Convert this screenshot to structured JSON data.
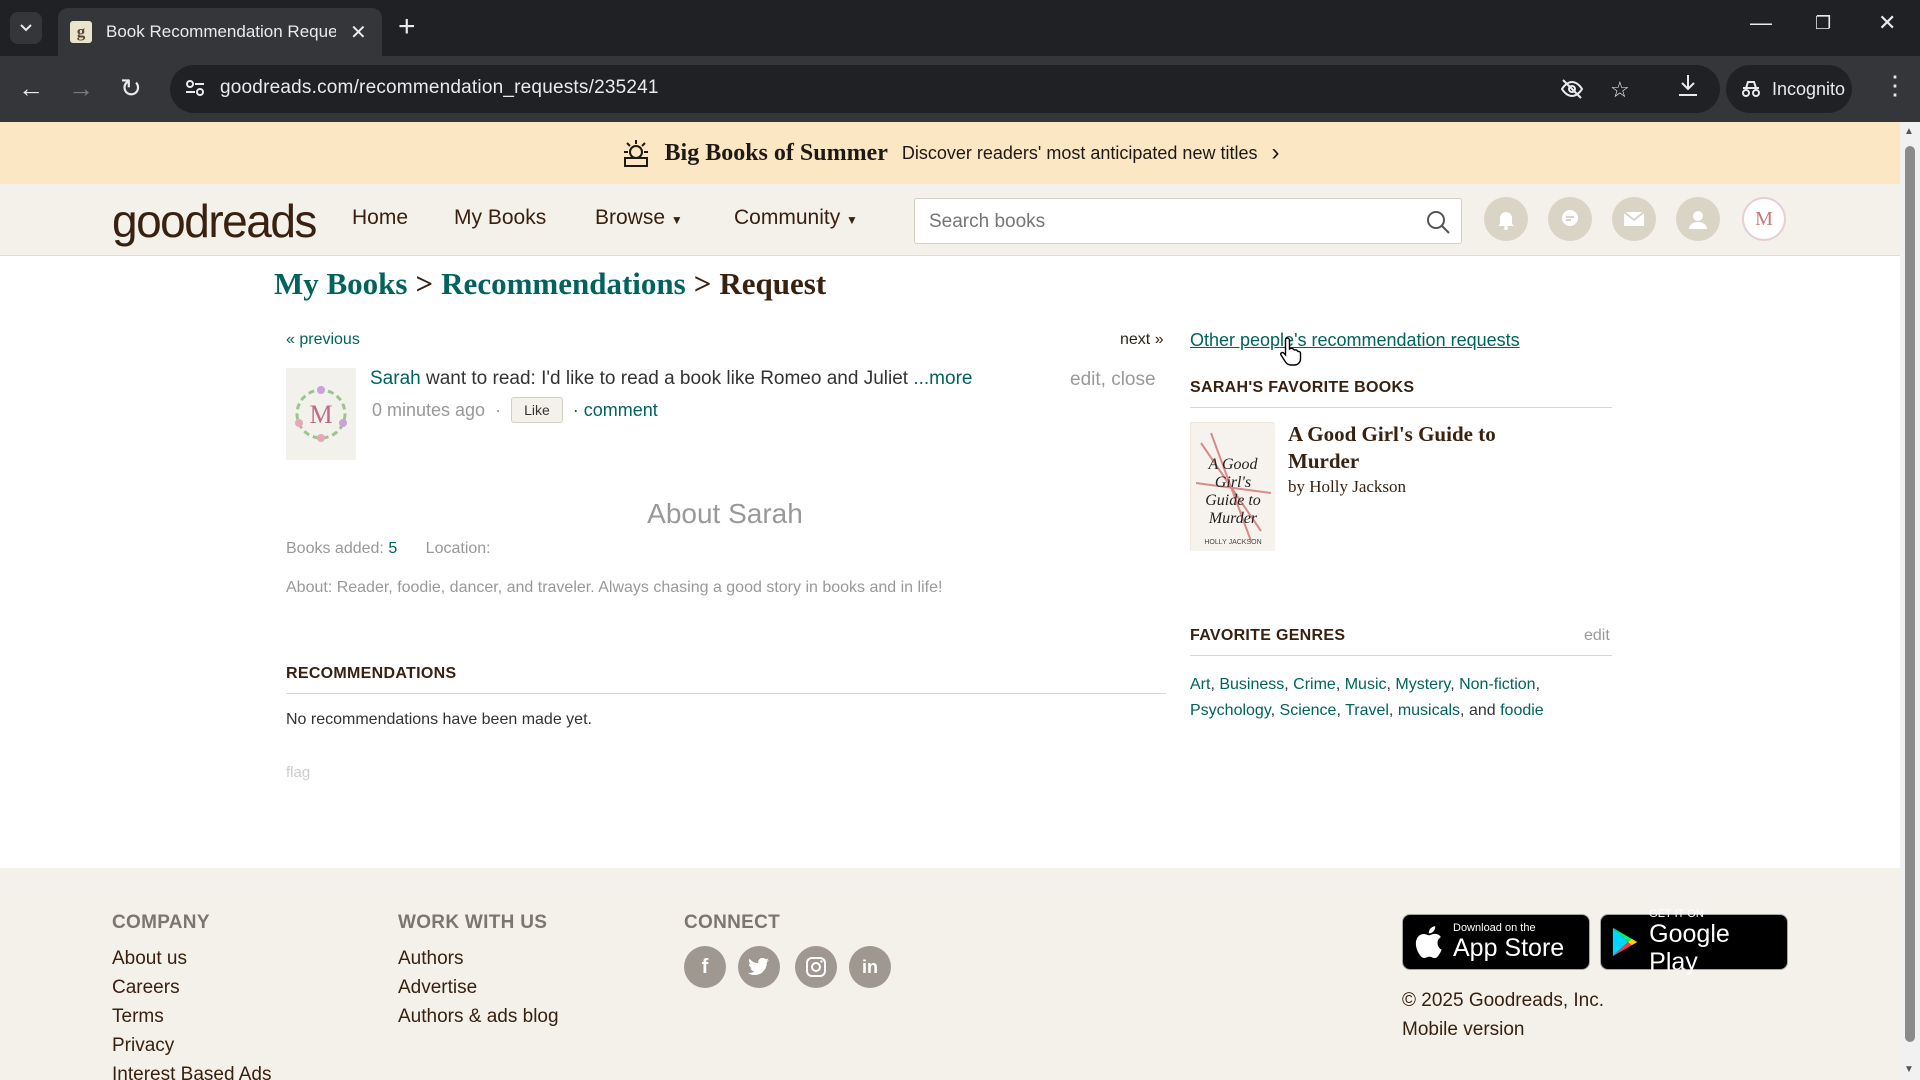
{
  "browser": {
    "tab_title": "Book Recommendation Reques",
    "url": "goodreads.com/recommendation_requests/235241",
    "incognito_label": "Incognito",
    "favicon_letter": "g"
  },
  "banner": {
    "title": "Big Books of Summer",
    "subtitle": "Discover readers' most anticipated new titles"
  },
  "header": {
    "logo": "goodreads",
    "nav": [
      "Home",
      "My Books",
      "Browse",
      "Community"
    ],
    "search_placeholder": "Search books"
  },
  "breadcrumb": {
    "items": [
      "My Books",
      "Recommendations",
      "Request"
    ],
    "separator": ">"
  },
  "request": {
    "previous": "« previous",
    "next": "next »",
    "user_name": "Sarah",
    "text": " want to read: I'd like to read a book like Romeo and Juliet ",
    "more": "...more",
    "edit_close": "edit, close",
    "time_ago": "0 minutes ago",
    "dot": "·",
    "like_label": "Like",
    "comment": "· comment"
  },
  "about": {
    "title": "About Sarah",
    "books_added_label": "Books added:",
    "books_added_value": "5",
    "location_label": "Location:",
    "about_text": "About: Reader, foodie, dancer, and traveler. Always chasing a good story in books and in life!"
  },
  "recommendations": {
    "heading": "RECOMMENDATIONS",
    "empty_text": "No recommendations have been made yet.",
    "flag": "flag"
  },
  "sidebar": {
    "other_requests_link": "Other people's recommendation requests",
    "favorite_books_heading": "SARAH'S FAVORITE BOOKS",
    "book_title": "A Good Girl's Guide to Murder",
    "book_by": "by",
    "book_author": "Holly Jackson",
    "cover_text": "A Good Girl's Guide to Murder",
    "cover_author": "HOLLY JACKSON",
    "genres_heading": "FAVORITE GENRES",
    "genres_edit": "edit",
    "genres": [
      "Art",
      "Business",
      "Crime",
      "Music",
      "Mystery",
      "Non-fiction",
      "Psychology",
      "Science",
      "Travel",
      "musicals",
      "foodie"
    ],
    "genres_and": "and"
  },
  "footer": {
    "company_heading": "COMPANY",
    "company_links": [
      "About us",
      "Careers",
      "Terms",
      "Privacy",
      "Interest Based Ads"
    ],
    "work_heading": "WORK WITH US",
    "work_links": [
      "Authors",
      "Advertise",
      "Authors & ads blog"
    ],
    "connect_heading": "CONNECT",
    "social": [
      "f",
      "t",
      "ig",
      "in"
    ],
    "app_store_small": "Download on the",
    "app_store_big": "App Store",
    "google_small": "GET IT ON",
    "google_big": "Google Play",
    "copyright": "© 2025 Goodreads, Inc.",
    "mobile": "Mobile version"
  },
  "colors": {
    "brand_green": "#00635d",
    "brand_brown": "#382110",
    "banner_bg": "#fbe7c3",
    "header_bg": "#f4f1ea"
  }
}
